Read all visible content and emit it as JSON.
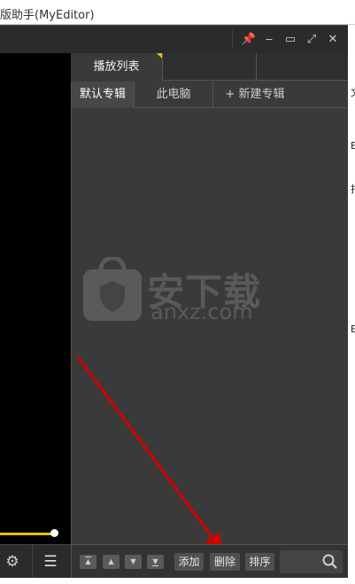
{
  "outer_window": {
    "title_fragment": "版助手(MyEditor)"
  },
  "window_controls": {
    "pin_label": "📌",
    "minimize_label": "‒",
    "maximize_label": "▭",
    "fullscreen_label": "⤢",
    "close_label": "✕"
  },
  "playlist": {
    "main_tab": "播放列表",
    "subtabs": [
      "默认专辑",
      "此电脑",
      "+ 新建专辑"
    ]
  },
  "watermark": {
    "brand": "安下载",
    "url": "anxz.com"
  },
  "player_controls": {
    "progress_percent": 100,
    "gear_label": "⚙",
    "menu_label": "☰"
  },
  "toolbar": {
    "move_top": "▲",
    "move_up": "▲",
    "move_down": "▼",
    "move_bottom": "▼",
    "add_label": "添加",
    "delete_label": "删除",
    "sort_label": "排序"
  },
  "colors": {
    "accent": "#e8c200",
    "panel": "#3a3a3a",
    "arrow": "#d40000"
  },
  "right_strip_chars": [
    "文",
    "E",
    "打",
    "E"
  ]
}
